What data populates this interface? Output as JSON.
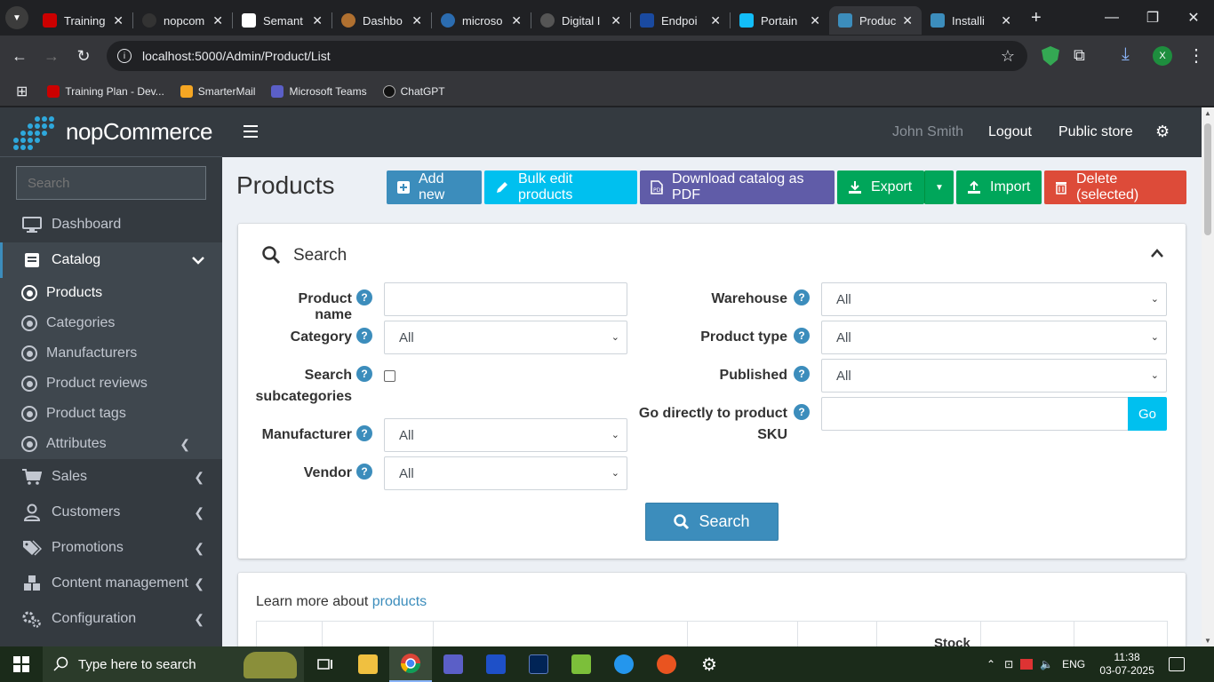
{
  "browser": {
    "tabs": [
      {
        "label": "Training",
        "color": "#c00"
      },
      {
        "label": "nopcom",
        "color": "#222"
      },
      {
        "label": "Semant",
        "color": "#fff"
      },
      {
        "label": "Dashbo",
        "color": "#b07030"
      },
      {
        "label": "microso",
        "color": "#2b6cb0"
      },
      {
        "label": "Digital I",
        "color": "#222"
      },
      {
        "label": "Endpoi",
        "color": "#1a4aa0"
      },
      {
        "label": "Portain",
        "color": "#13bef9"
      },
      {
        "label": "Produc",
        "color": "#3c8dbc"
      },
      {
        "label": "Installi",
        "color": "#3c8dbc"
      }
    ],
    "url": "localhost:5000/Admin/Product/List",
    "profile_initial": "X",
    "bookmarks": [
      {
        "label": "Training Plan - Dev...",
        "color": "#c00"
      },
      {
        "label": "SmarterMail",
        "color": "#f5a623"
      },
      {
        "label": "Microsoft Teams",
        "color": "#5b5fc7"
      },
      {
        "label": "ChatGPT",
        "color": "#222"
      }
    ]
  },
  "sidebar": {
    "brand": "nopCommerce",
    "search_placeholder": "Search",
    "items": [
      {
        "label": "Dashboard"
      },
      {
        "label": "Catalog"
      },
      {
        "label": "Sales"
      },
      {
        "label": "Customers"
      },
      {
        "label": "Promotions"
      },
      {
        "label": "Content management"
      },
      {
        "label": "Configuration"
      }
    ],
    "catalog_sub": [
      {
        "label": "Products"
      },
      {
        "label": "Categories"
      },
      {
        "label": "Manufacturers"
      },
      {
        "label": "Product reviews"
      },
      {
        "label": "Product tags"
      },
      {
        "label": "Attributes"
      }
    ]
  },
  "topnav": {
    "user": "John Smith",
    "logout": "Logout",
    "public_store": "Public store"
  },
  "page": {
    "title": "Products",
    "buttons": {
      "add_new": "Add new",
      "bulk_edit": "Bulk edit products",
      "download_pdf": "Download catalog as PDF",
      "export": "Export",
      "import": "Import",
      "delete_selected": "Delete (selected)"
    },
    "search_panel": {
      "title": "Search",
      "product_name_label": "Product name",
      "product_name_value": "",
      "category_label": "Category",
      "category_value": "All",
      "search_sub_label_1": "Search",
      "search_sub_label_2": "subcategories",
      "manufacturer_label": "Manufacturer",
      "manufacturer_value": "All",
      "vendor_label": "Vendor",
      "vendor_value": "All",
      "warehouse_label": "Warehouse",
      "warehouse_value": "All",
      "product_type_label": "Product type",
      "product_type_value": "All",
      "published_label": "Published",
      "published_value": "All",
      "goto_sku_label_1": "Go directly to product",
      "goto_sku_label_2": "SKU",
      "goto_sku_value": "",
      "go_button": "Go",
      "search_button": "Search"
    },
    "learn_more_prefix": "Learn more about",
    "learn_more_link": "products",
    "table_header_partial": "Stock"
  },
  "taskbar": {
    "search_placeholder": "Type here to search",
    "lang": "ENG",
    "time": "11:38",
    "date": "03-07-2025"
  }
}
